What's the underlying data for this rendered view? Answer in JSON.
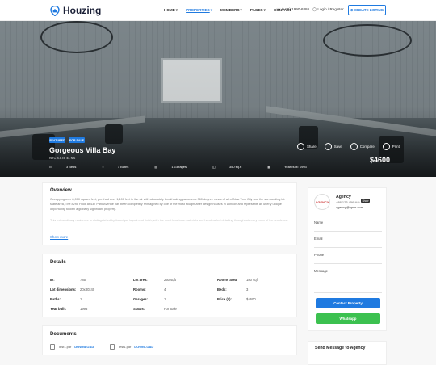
{
  "header": {
    "brand": "Houzing",
    "menu": [
      "HOME",
      "PROPERTIES",
      "MEMBERS",
      "PAGES",
      "CONTACT"
    ],
    "active_menu": "PROPERTIES",
    "phone": "(+88) 1990-6886",
    "login": "Login / Register",
    "create_listing": "CREATE LISTING",
    "colors": {
      "accent": "#1f7ae0",
      "whatsapp": "#3cc150"
    }
  },
  "hero": {
    "badges": [
      "FEATURED",
      "FOR SALE"
    ],
    "title": "Gorgeous Villa Bay",
    "address": "NYC 4 ATE 4L NS",
    "facts": [
      "3 Beds",
      "1 Baths",
      "1 Garages",
      "350 sq.ft",
      "Year built: 1993"
    ],
    "actions": [
      "Share",
      "Save",
      "Compare",
      "Print"
    ],
    "price": "$4600"
  },
  "overview": {
    "title": "Overview",
    "paragraph1": "Occupying over 8,000 square feet, perched over 1,100 feet in the air with absolutely breathtaking panoramic 360-degree views of all of New York City and the surrounding tri-state area, The 82nd Floor at 432 Park Avenue has been completely reimagined by one of the most sought-after design houses in London and represents an utterly unique opportunity to own a globally significant property.",
    "paragraph2": "This extraordinary residence is distinguished by its unique layout and finish, with the most luxurious materials and handcrafted detailing throughout every room of the residence.",
    "show_more": "Show more"
  },
  "details": {
    "title": "Details",
    "rows": [
      [
        {
          "label": "ID:",
          "value": "785"
        },
        {
          "label": "Lot area:",
          "value": "250 sqft"
        },
        {
          "label": "Rooms area:",
          "value": "180 sqft"
        }
      ],
      [
        {
          "label": "Lot dimensions:",
          "value": "20x30x40"
        },
        {
          "label": "Rooms:",
          "value": "4"
        },
        {
          "label": "Beds:",
          "value": "3"
        }
      ],
      [
        {
          "label": "Baths:",
          "value": "1"
        },
        {
          "label": "Garages:",
          "value": "1"
        },
        {
          "label": "Price ($):",
          "value": "$4600"
        }
      ],
      [
        {
          "label": "Year built:",
          "value": "1993"
        },
        {
          "label": "Status:",
          "value": "For Sale"
        },
        {
          "label": "",
          "value": ""
        }
      ]
    ]
  },
  "documents": {
    "title": "Documents",
    "files": [
      {
        "name": "Test1.pdf",
        "action": "DOWNLOAD"
      },
      {
        "name": "Test1.pdf",
        "action": "DOWNLOAD"
      }
    ]
  },
  "agent": {
    "logo_text": "AGENCY",
    "name": "Agency",
    "phone": "+88 123 456 ****",
    "show": "Show",
    "email": "agency@ypus.com",
    "fields": [
      "Name",
      "Email",
      "Phone",
      "Message"
    ],
    "contact_button": "Contact Property",
    "whatsapp_button": "Whatsapp"
  },
  "send_message": {
    "title": "Send Message to Agency"
  }
}
